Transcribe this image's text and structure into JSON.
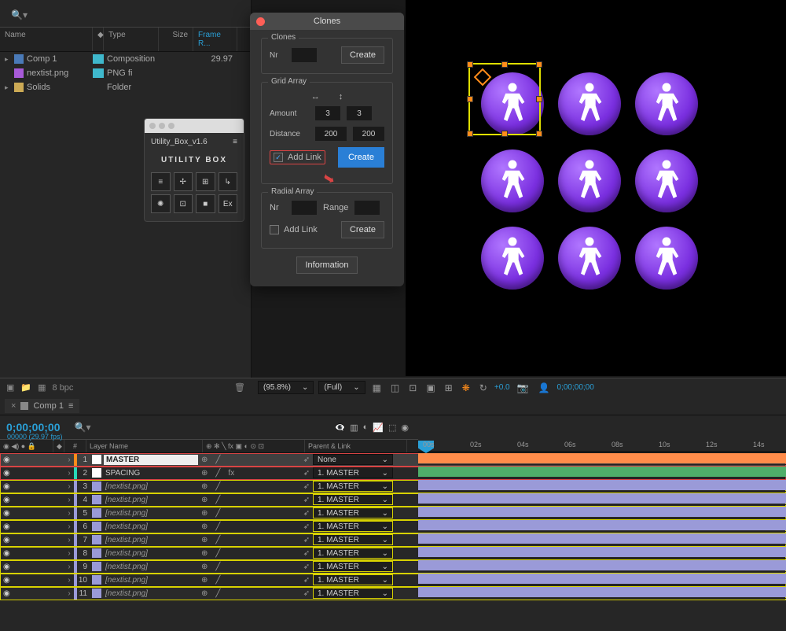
{
  "project": {
    "headers": {
      "name": "Name",
      "type": "Type",
      "size": "Size",
      "frame": "Frame R..."
    },
    "rows": [
      {
        "name": "Comp 1",
        "type": "Composition",
        "fr": "29.97",
        "icon": "comp",
        "tag": "aqua",
        "tw": "▸"
      },
      {
        "name": "nextist.png",
        "type": "PNG fi",
        "fr": "",
        "icon": "png",
        "tag": "aqua",
        "tw": ""
      },
      {
        "name": "Solids",
        "type": "Folder",
        "fr": "",
        "icon": "fold",
        "tag": "none",
        "tw": "▸"
      }
    ],
    "footer_bpc": "8 bpc"
  },
  "utilbox": {
    "title": "Utility_Box_v1.6",
    "logo": "UTILITY BOX",
    "btns": [
      "≡",
      "✢",
      "⊞",
      "↳",
      "✺",
      "⊡",
      "■",
      "Ex"
    ]
  },
  "clones": {
    "title": "Clones",
    "sec1": {
      "legend": "Clones",
      "nr": "Nr",
      "create": "Create"
    },
    "sec2": {
      "legend": "Grid Array",
      "amount": "Amount",
      "a1": "3",
      "a2": "3",
      "distance": "Distance",
      "d1": "200",
      "d2": "200",
      "addlink": "Add Link",
      "create": "Create",
      "arr_h": "↔",
      "arr_v": "↕"
    },
    "sec3": {
      "legend": "Radial Array",
      "nr": "Nr",
      "range": "Range",
      "addlink": "Add Link",
      "create": "Create"
    },
    "info": "Information"
  },
  "viewfoot": {
    "zoom": "(95.8%)",
    "res": "(Full)",
    "exp": "+0.0",
    "tc": "0;00;00;00"
  },
  "timeline": {
    "tab": "Comp 1",
    "tc": "0;00;00;00",
    "tc_sub": "00000 (29.97 fps)",
    "cols": {
      "idx": "#",
      "name": "Layer Name",
      "parent": "Parent & Link"
    },
    "ruler": [
      "00s",
      "02s",
      "04s",
      "06s",
      "08s",
      "10s",
      "12s",
      "14s"
    ],
    "rows": [
      {
        "i": "1",
        "name": "MASTER",
        "tag": "#ff8c1a",
        "sq": "#fff",
        "par": "None",
        "fx": "",
        "ital": false,
        "sel": true,
        "hl": "red",
        "bar": "orange"
      },
      {
        "i": "2",
        "name": "SPACING",
        "tag": "#27d8b8",
        "sq": "#fff",
        "par": "1. MASTER",
        "fx": "fx",
        "ital": false,
        "sel": false,
        "hl": "red",
        "bar": "green"
      },
      {
        "i": "3",
        "name": "[nextist.png]",
        "tag": "#9a9ad8",
        "sq": "#9a9ad8",
        "par": "1. MASTER",
        "fx": "",
        "ital": true,
        "sel": false,
        "hl": "yel",
        "bar": "lav"
      },
      {
        "i": "4",
        "name": "[nextist.png]",
        "tag": "#9a9ad8",
        "sq": "#9a9ad8",
        "par": "1. MASTER",
        "fx": "",
        "ital": true,
        "sel": false,
        "hl": "yel",
        "bar": "lav"
      },
      {
        "i": "5",
        "name": "[nextist.png]",
        "tag": "#9a9ad8",
        "sq": "#9a9ad8",
        "par": "1. MASTER",
        "fx": "",
        "ital": true,
        "sel": false,
        "hl": "yel",
        "bar": "lav"
      },
      {
        "i": "6",
        "name": "[nextist.png]",
        "tag": "#9a9ad8",
        "sq": "#9a9ad8",
        "par": "1. MASTER",
        "fx": "",
        "ital": true,
        "sel": false,
        "hl": "yel",
        "bar": "lav"
      },
      {
        "i": "7",
        "name": "[nextist.png]",
        "tag": "#9a9ad8",
        "sq": "#9a9ad8",
        "par": "1. MASTER",
        "fx": "",
        "ital": true,
        "sel": false,
        "hl": "yel",
        "bar": "lav"
      },
      {
        "i": "8",
        "name": "[nextist.png]",
        "tag": "#9a9ad8",
        "sq": "#9a9ad8",
        "par": "1. MASTER",
        "fx": "",
        "ital": true,
        "sel": false,
        "hl": "yel",
        "bar": "lav"
      },
      {
        "i": "9",
        "name": "[nextist.png]",
        "tag": "#9a9ad8",
        "sq": "#9a9ad8",
        "par": "1. MASTER",
        "fx": "",
        "ital": true,
        "sel": false,
        "hl": "yel",
        "bar": "lav"
      },
      {
        "i": "10",
        "name": "[nextist.png]",
        "tag": "#9a9ad8",
        "sq": "#9a9ad8",
        "par": "1. MASTER",
        "fx": "",
        "ital": true,
        "sel": false,
        "hl": "yel",
        "bar": "lav"
      },
      {
        "i": "11",
        "name": "[nextist.png]",
        "tag": "#9a9ad8",
        "sq": "#9a9ad8",
        "par": "1. MASTER",
        "fx": "",
        "ital": true,
        "sel": false,
        "hl": "yel",
        "bar": "lav"
      }
    ]
  }
}
